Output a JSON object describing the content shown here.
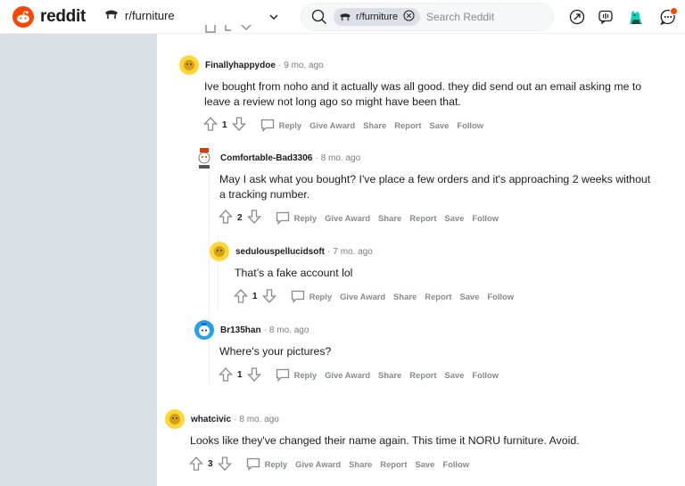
{
  "app": {
    "logo_text": "reddit",
    "community": "r/furniture",
    "search_chip": "r/furniture",
    "search_placeholder": "Search Reddit",
    "colors": {
      "brand": "#ff4500",
      "teal": "#0dd3bb",
      "text": "#1c1c1c",
      "meta": "#7c7c7c",
      "action": "#878a8c"
    },
    "icons": [
      "reddit-logo-icon",
      "chevron-down-icon",
      "search-icon",
      "close-circle-icon",
      "popular-arrow-icon",
      "coins-icon",
      "avatar-icon",
      "chat-icon"
    ]
  },
  "comments": [
    {
      "author": "Finallyhappydoe",
      "time": "9 mo. ago",
      "body": "Ive bought from noho and it actually was all good. they did send out an email asking me to leave a review not long ago so might have been that.",
      "votes": "1"
    },
    {
      "author": "Comfortable-Bad3306",
      "time": "8 mo. ago",
      "body": "May I ask what you bought? I've place a few orders and it's approaching 2 weeks without a tracking number.",
      "votes": "2"
    },
    {
      "author": "sedulouspellucidsoft",
      "time": "7 mo. ago",
      "body": "That’s a fake account lol",
      "votes": "1"
    },
    {
      "author": "Br135han",
      "time": "8 mo. ago",
      "body": "Where's your pictures?",
      "votes": "1"
    },
    {
      "author": "whatcivic",
      "time": "8 mo. ago",
      "body": "Looks like they've changed their name again. This time it NORU furniture. Avoid.",
      "votes": "3"
    }
  ],
  "actions": {
    "reply": "Reply",
    "give_award": "Give Award",
    "share": "Share",
    "report": "Report",
    "save": "Save",
    "follow": "Follow"
  }
}
